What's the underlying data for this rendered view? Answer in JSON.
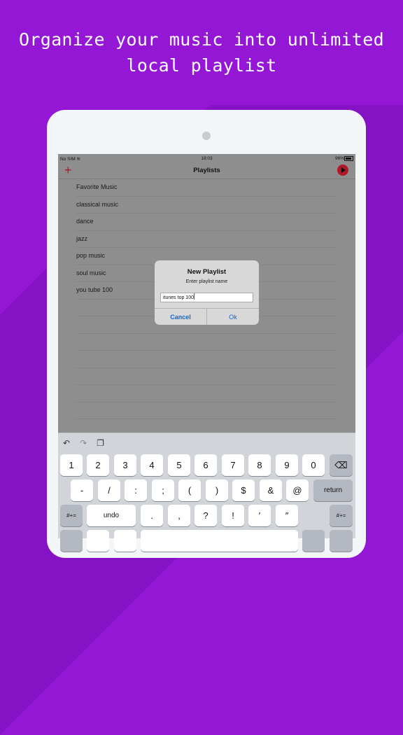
{
  "headline": [
    "Organize your music into unlimited",
    "local playlist"
  ],
  "status": {
    "carrier": "No SIM",
    "time": "18:03",
    "battery": "96%"
  },
  "nav": {
    "title": "Playlists"
  },
  "playlists": [
    "Favorite Music",
    "classical music",
    "dance",
    "jazz",
    "pop music",
    "soul music",
    "you tube 100"
  ],
  "dialog": {
    "title": "New Playlist",
    "message": "Enter playlist name",
    "input_value": "itunes top 100",
    "cancel": "Cancel",
    "ok": "Ok"
  },
  "keyboard": {
    "row1": [
      "1",
      "2",
      "3",
      "4",
      "5",
      "6",
      "7",
      "8",
      "9",
      "0"
    ],
    "row2": [
      "-",
      "/",
      ":",
      ";",
      "(",
      ")",
      "$",
      "&",
      "@"
    ],
    "return": "return",
    "row3_mod": "#+=",
    "undo": "undo",
    "row3": [
      ".",
      ",",
      "?",
      "!",
      "′",
      "″"
    ],
    "row3_mod_right": "#+="
  },
  "colors": {
    "background": "#9417d6",
    "accent": "#b0182a",
    "link": "#1565c8"
  }
}
